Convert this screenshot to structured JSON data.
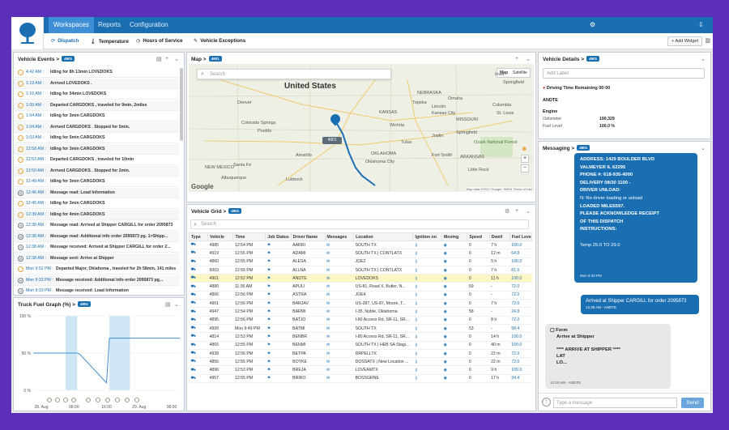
{
  "nav": {
    "tabs": [
      "Workspaces",
      "Reports",
      "Configuration"
    ]
  },
  "subnav": {
    "tabs": [
      {
        "icon": "refresh-icon",
        "label": "Dispatch"
      },
      {
        "icon": "thermometer-icon",
        "label": "Temperature"
      },
      {
        "icon": "clock-icon",
        "label": "Hours of Service"
      },
      {
        "icon": "wrench-icon",
        "label": "Vehicle Exceptions"
      }
    ],
    "add_widget": "+ Add Widget"
  },
  "events": {
    "title": "Vehicle Events >",
    "badge": "4901",
    "rows": [
      {
        "time": "4:42 AM :",
        "text": "Idling for 8h 13min LOVEDOKS"
      },
      {
        "time": "1:19 AM :",
        "text": "Arrived LOVEDOKS ."
      },
      {
        "time": "1:16 AM :",
        "text": "Idling for 54min LOVEDOKS"
      },
      {
        "time": "1:09 AM :",
        "text": "Departed CARGDOKS , traveled for 9min, 2miles"
      },
      {
        "time": "1:04 AM :",
        "text": "Idling for 3min CARGDOKS"
      },
      {
        "time": "1:04 AM :",
        "text": "Arrived CARGDOKS . Stopped for 5min."
      },
      {
        "time": "1:03 AM :",
        "text": "Idling for 5min CARGDOKS"
      },
      {
        "time": "12:58 AM :",
        "text": "Idling for 3min CARGDOKS"
      },
      {
        "time": "12:53 AM :",
        "text": "Departed CARGDOKS , traveled for 10min"
      },
      {
        "time": "12:50 AM :",
        "text": "Arrived CARGDOKS . Stopped for 2min."
      },
      {
        "time": "12:49 AM :",
        "text": "Idling for 3min CARGDOKS"
      },
      {
        "time": "12:46 AM :",
        "text": "Message read: Load Information"
      },
      {
        "time": "12:45 AM :",
        "text": "Idling for 3min CARGDOKS"
      },
      {
        "time": "12:39 AM :",
        "text": "Idling for 4min CARGDOKS"
      },
      {
        "time": "12:38 AM :",
        "text": "Message read: Arrived at Shipper CARGILL for order 2095873"
      },
      {
        "time": "12:38 AM :",
        "text": "Message read: Additional info order 2095873 pg. 1>Shipp..."
      },
      {
        "time": "12:38 AM :",
        "text": "Message received: Arrived at Shipper CARGILL for order 2..."
      },
      {
        "time": "12:38 AM :",
        "text": "Message sent: Arrive at Shipper"
      },
      {
        "time": "Mon 9:52 PM :",
        "text": "Departed Major, Oklahoma , traveled for 2h 58min, 141 miles"
      },
      {
        "time": "Mon 9:33 PM :",
        "text": "Message received: Additional info order 2095873 pg..."
      },
      {
        "time": "Mon 9:33 PM :",
        "text": "Message received: Load Information"
      }
    ]
  },
  "fuel": {
    "title": "Truck Fuel Graph (%) >",
    "badge": "4901"
  },
  "chart_data": {
    "type": "line",
    "title": "Truck Fuel Graph (%)",
    "x_ticks": [
      "28. Aug",
      "08:00",
      "16:00",
      "29. Aug",
      "08:00"
    ],
    "y_ticks": [
      "100 %",
      "50 %",
      "0 %"
    ],
    "ylim": [
      0,
      100
    ],
    "series": [
      {
        "x": [
          0,
          0.3,
          0.32,
          0.5,
          0.52,
          0.6,
          0.62,
          1.0
        ],
        "values": [
          50,
          50,
          48,
          10,
          70,
          70,
          70,
          70
        ]
      }
    ],
    "grid": true
  },
  "map": {
    "title": "Map >",
    "badge": "4901",
    "search_placeholder": "Search",
    "types": [
      "Map",
      "Satellite"
    ],
    "country": "United States",
    "labels": [
      "NEBRASKA",
      "Omaha",
      "Lincoln",
      "Denver",
      "Colorado Springs",
      "KANSAS",
      "Wichita",
      "Kansas City",
      "Topeka",
      "MISSOURI",
      "St. Louis",
      "Springfield",
      "Tulsa",
      "OKLAHOMA",
      "Oklahoma City",
      "Amarillo",
      "Albuquerque",
      "NEW MEXICO",
      "Santa Fe",
      "Lubbock",
      "ARKANSAS",
      "Little Rock",
      "Ozark National Forest",
      "Fort Smith",
      "Iowa",
      "Joplin",
      "Pueblo",
      "Columbia",
      "Springfield"
    ],
    "vehicle_label": "4901",
    "copyright": "Map data ©2017 Google, INEGI  Terms of Use"
  },
  "grid": {
    "title": "Vehicle Grid >",
    "badge": "4901",
    "search_placeholder": "Search",
    "columns": [
      "Type",
      "Vehicle",
      "Time",
      "Job Status",
      "Driver Name",
      "Messages",
      "Location",
      "Ignition on",
      "Moving",
      "Speed",
      "Dwell",
      "Fuel Level"
    ],
    "rows": [
      [
        "4985",
        "12:54 PM",
        "AARRI",
        "SOUTH TX",
        "0",
        "7 h",
        "100.0"
      ],
      [
        "4919",
        "12:55 PM",
        "ADAMI",
        "SOUTH TX | CONTLATX",
        "0",
        "12 m",
        "64.8"
      ],
      [
        "4860",
        "12:55 PM",
        "ALESA",
        "JOE2",
        "0",
        "5 h",
        "100.0"
      ],
      [
        "5003",
        "12:55 PM",
        "ALLNA",
        "SOUTH TX | CONTLATX",
        "0",
        "7 h",
        "81.6"
      ],
      [
        "4901",
        "12:52 PM",
        "ANDTE",
        "LOVEDOKS",
        "0",
        "11 h",
        "100.0"
      ],
      [
        "4880",
        "11:36 AM",
        "APULI",
        "US-81, Road X, Butler, N...",
        "59",
        "-",
        "72.0"
      ],
      [
        "4866",
        "12:56 PM",
        "ASTRA",
        "JOE4",
        "0",
        "-",
        "72.0"
      ],
      [
        "4901",
        "12:56 PM",
        "BARJAV",
        "US-287, US-87, Moore, T...",
        "0",
        "7 h",
        "72.0"
      ],
      [
        "4947",
        "12:54 PM",
        "BARMI",
        "I-35, Noble, Oklahoma",
        "58",
        "-",
        "24.8"
      ],
      [
        "4895",
        "12:56 PM",
        "BATJO",
        "I-80 Access Rd, SR-11, SR...",
        "0",
        "8 h",
        "72.0"
      ],
      [
        "4999",
        "Mon 9:49 PM",
        "BATMI",
        "SOUTH TX",
        "53",
        "-",
        "98.4"
      ],
      [
        "4814",
        "12:53 PM",
        "BENBR",
        "I-80 Access Rd, SR-11, SR...",
        "0",
        "14 h",
        "100.0"
      ],
      [
        "4865",
        "12:55 PM",
        "BENMI",
        "SOUTH TX | HEB SA Stagi...",
        "0",
        "40 m",
        "100.0"
      ],
      [
        "4938",
        "12:56 PM",
        "BETPA",
        "DRPELLTX",
        "0",
        "22 m",
        "72.0"
      ],
      [
        "4856",
        "12:55 PM",
        "BOYKE",
        "DOSSATX | New Location ...",
        "0",
        "22 m",
        "72.0"
      ],
      [
        "4896",
        "12:53 PM",
        "BREJA",
        "LOVEAMTX",
        "0",
        "9 h",
        "100.0"
      ],
      [
        "4957",
        "12:55 PM",
        "BRIRO",
        "BOSSGRNE",
        "0",
        "17 h",
        "34.4"
      ]
    ]
  },
  "details": {
    "title": "Vehicle Details >",
    "badge": "4901",
    "label_placeholder": "Add Label",
    "warning": "Driving Time Remaining 00:00",
    "driver": "ANDTE",
    "engine_title": "Engine",
    "odometer_label": "Odometer",
    "odometer_value": "190,329",
    "fuel_label": "Fuel Level",
    "fuel_value": "100.0 %"
  },
  "messaging": {
    "title": "Messaging >",
    "badge": "4901",
    "bubble1": {
      "lines": [
        "ADDRESS: 1429 BOULDER BLVD",
        "VALMEYER IL 62295",
        "PHONE #: 618-935-4000",
        "DELIVERY 08/30  1100  -",
        "DRIVER UNLOAD:",
        "N: No driver loading or unload",
        "LOADED MILES597.",
        "PLEASE ACKNOWLEDGE RECEIPT",
        "OF THIS DISPATCH",
        "INSTRUCTIONS:",
        "",
        "Temp 25.0 TO 29.0"
      ],
      "meta": "Mon 9:30 PM"
    },
    "bubble2": {
      "text": "Arrived at Shipper CARGILL for order 2095873",
      "meta": "12:38 AM - ANDTE"
    },
    "bubble3": {
      "form_label": "Form",
      "form_title": "Arrive at Shipper",
      "line1": "**** ARRIVE AT SHIPPER ****",
      "line2": "LAT",
      "line3": "LO...",
      "meta": "12:44 AM - ANDTE"
    },
    "input_placeholder": "Type a message",
    "send_label": "Send"
  },
  "colors": {
    "brand": "#1a6fb3",
    "highlight_row": "#fcf6c4",
    "frame": "#5b2fb8"
  }
}
